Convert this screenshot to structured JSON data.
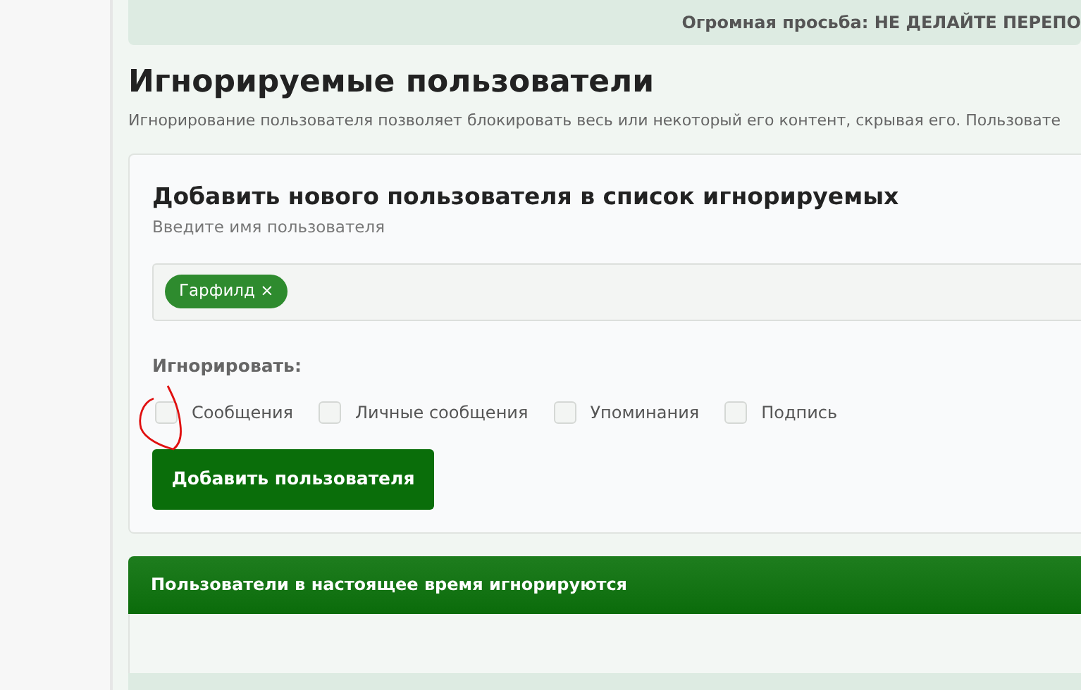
{
  "notice": "Огромная просьба: НЕ ДЕЛАЙТЕ ПЕРЕПО",
  "page": {
    "title": "Игнорируемые пользователи",
    "description": "Игнорирование пользователя позволяет блокировать весь или некоторый его контент, скрывая его. Пользовате"
  },
  "add_form": {
    "title": "Добавить нового пользователя в список игнорируемых",
    "hint": "Введите имя пользователя",
    "tags": [
      {
        "label": "Гарфилд",
        "remove": "×"
      }
    ],
    "ignore_label": "Игнорировать:",
    "options": [
      {
        "label": "Сообщения",
        "checked": false
      },
      {
        "label": "Личные сообщения",
        "checked": false
      },
      {
        "label": "Упоминания",
        "checked": false
      },
      {
        "label": "Подпись",
        "checked": false
      }
    ],
    "button": "Добавить пользователя"
  },
  "ignored_list": {
    "title": "Пользователи в настоящее время игнорируются"
  }
}
